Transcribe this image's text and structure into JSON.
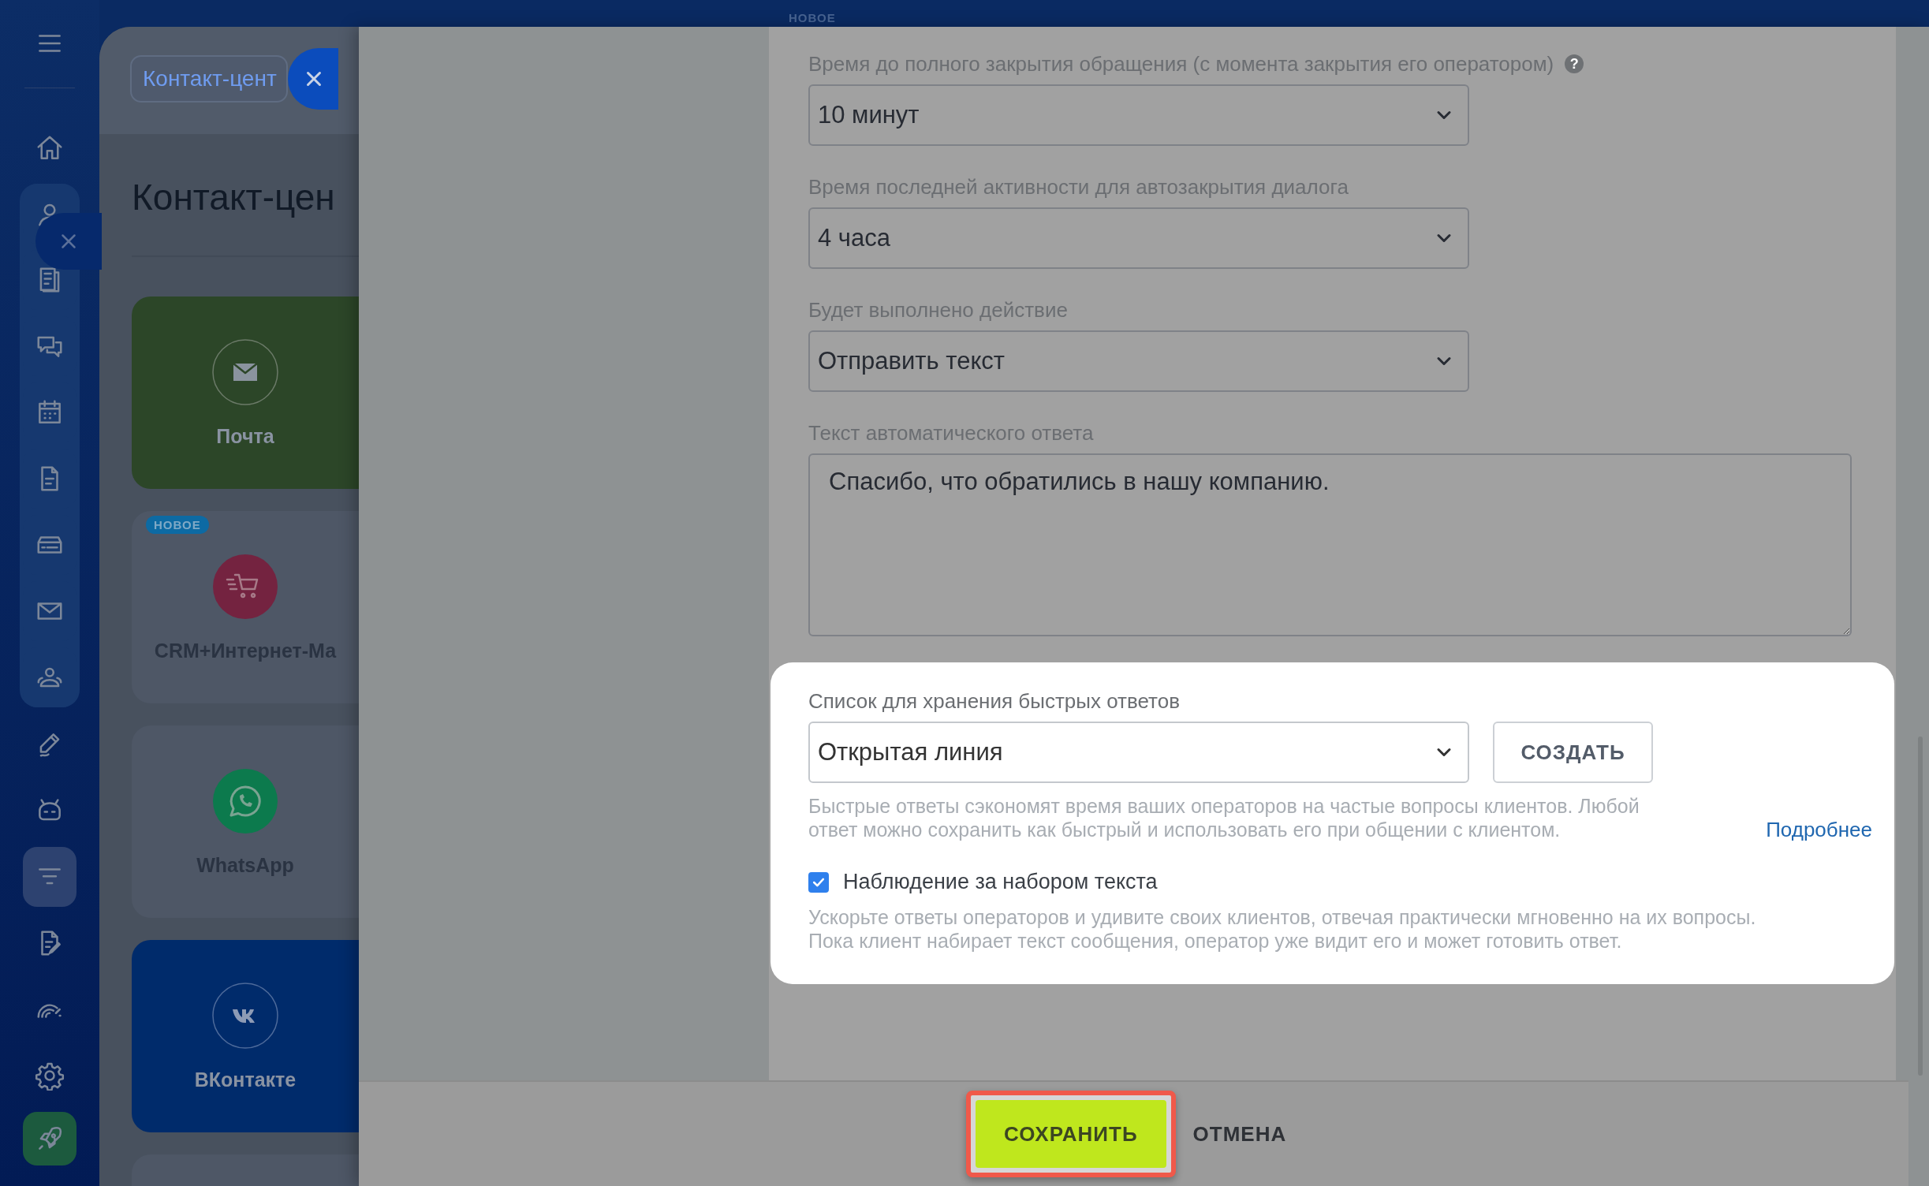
{
  "sidebar": {
    "items": [
      {
        "kind": "menu",
        "selected": false,
        "group": false
      },
      {
        "kind": "home",
        "selected": false,
        "group": false
      },
      {
        "kind": "user",
        "selected": false,
        "group": true
      },
      {
        "kind": "news",
        "selected": false,
        "group": true
      },
      {
        "kind": "chat",
        "selected": false,
        "group": true
      },
      {
        "kind": "calendar",
        "selected": false,
        "group": true
      },
      {
        "kind": "document",
        "selected": false,
        "group": true
      },
      {
        "kind": "drive",
        "selected": false,
        "group": true
      },
      {
        "kind": "mail",
        "selected": false,
        "group": true
      },
      {
        "kind": "contacts",
        "selected": false,
        "group": true
      },
      {
        "kind": "pen",
        "selected": false,
        "group": false
      },
      {
        "kind": "robot",
        "selected": false,
        "group": false
      },
      {
        "kind": "filter",
        "selected": true,
        "group": false
      },
      {
        "kind": "document-edit",
        "selected": false,
        "group": false
      },
      {
        "kind": "gauge",
        "selected": false,
        "group": false
      },
      {
        "kind": "settings",
        "selected": false,
        "group": false
      },
      {
        "kind": "rocket",
        "selected": false,
        "group": false
      }
    ]
  },
  "header_badge": "НОВОЕ",
  "background_page": {
    "tab": {
      "label": "Контакт-цент"
    },
    "title": "Контакт-цен",
    "cards": [
      {
        "kind": "mail",
        "label": "Почта",
        "color": "#2c4628"
      },
      {
        "kind": "shop",
        "label": "CRM+Интернет-Ма",
        "badge": "НОВОЕ",
        "color": "#4e5766"
      },
      {
        "kind": "whatsapp",
        "label": "WhatsApp",
        "color": "#4e5766"
      },
      {
        "kind": "vk",
        "label": "ВКонтакте",
        "color": "#002b6b"
      },
      {
        "kind": "blank",
        "color": "#4e5766"
      }
    ]
  },
  "form": {
    "fields": [
      {
        "kind": "select",
        "label": "Время до полного закрытия обращения (с момента закрытия его оператором)",
        "help": "?",
        "value": "10 минут"
      },
      {
        "kind": "select",
        "label": "Время последней активности для автозакрытия диалога",
        "value": "4 часа"
      },
      {
        "kind": "select",
        "label": "Будет выполнено действие",
        "value": "Отправить текст"
      },
      {
        "kind": "textarea",
        "label": "Текст автоматического ответа",
        "value": "Спасибо, что обратились в нашу компанию."
      }
    ],
    "quick_answers": {
      "label": "Список для хранения быстрых ответов",
      "value": "Открытая линия",
      "button": "СОЗДАТЬ",
      "hint": "Быстрые ответы сэкономят время ваших операторов на частые вопросы клиентов. Любой ответ можно сохранить как быстрый и использовать его при общении с клиентом.",
      "link": "Подробнее"
    },
    "typing_watch": {
      "label": "Наблюдение за набором текста",
      "checked": true,
      "description": "Ускорьте ответы операторов и удивите своих клиентов, отвечая практически мгновенно на их вопросы. Пока клиент набирает текст сообщения, оператор уже видит его и может готовить ответ."
    }
  },
  "footer": {
    "buttons": [
      {
        "kind": "primary",
        "label": "СОХРАНИТЬ",
        "highlighted": true
      },
      {
        "kind": "link",
        "label": "ОТМЕНА",
        "highlighted": false
      }
    ]
  }
}
